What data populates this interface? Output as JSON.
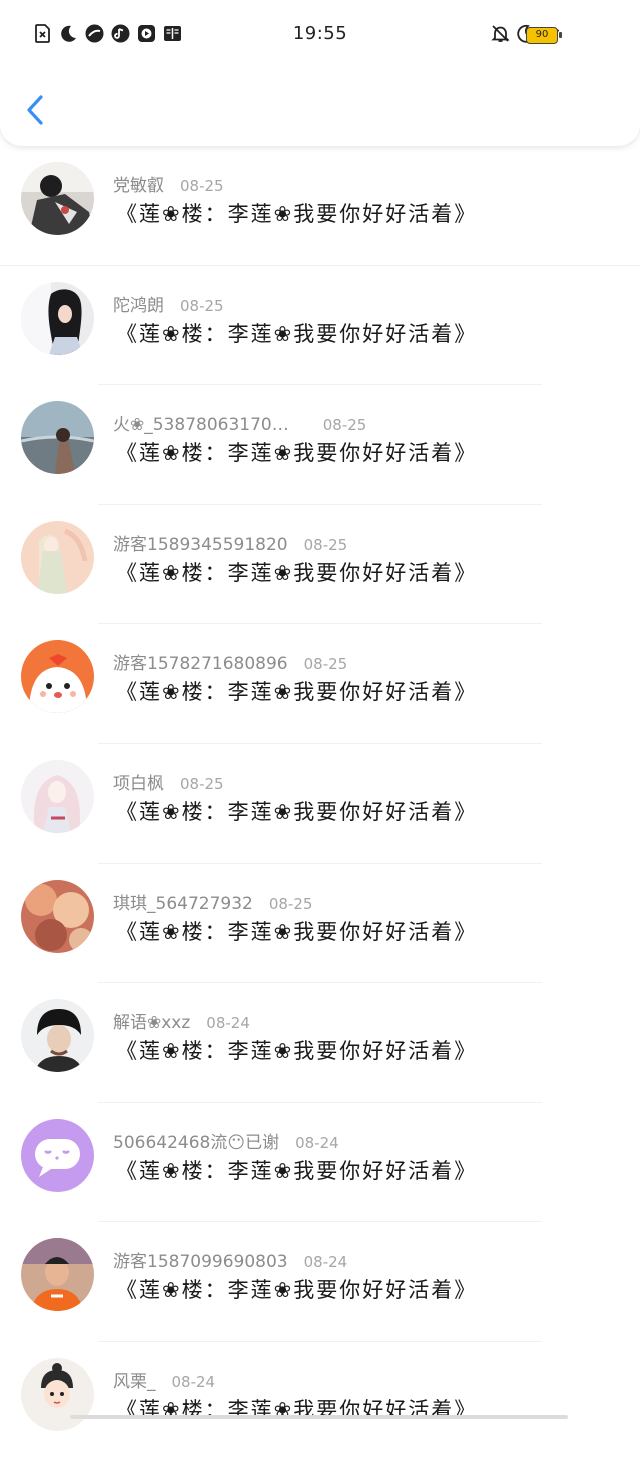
{
  "status_bar": {
    "time": "19:55",
    "battery": "90",
    "left_icons": [
      "sim-x-icon",
      "moon-icon",
      "cloud-app-icon",
      "music-app-icon",
      "video-app-icon",
      "book-app-icon"
    ],
    "right_icons": [
      "mute-bell-icon",
      "moon-icon",
      "wifi-icon"
    ]
  },
  "header": {
    "back_icon": "chevron-left-icon",
    "accent_color": "#3a8ef6"
  },
  "list": {
    "items": [
      {
        "name": "党敏叡",
        "date": "08-25",
        "title": "《莲❀楼：李莲❀我要你好好活着》",
        "avatar": "photo-dark"
      },
      {
        "name": "陀鸿朗",
        "date": "08-25",
        "title": "《莲❀楼：李莲❀我要你好好活着》",
        "avatar": "photo-girl"
      },
      {
        "name": "火❀_53878063170…",
        "date": "08-25",
        "title": "《莲❀楼：李莲❀我要你好好活着》",
        "avatar": "photo-sea"
      },
      {
        "name": "游客1589345591820",
        "date": "08-25",
        "title": "《莲❀楼：李莲❀我要你好好活着》",
        "avatar": "photo-peach"
      },
      {
        "name": "游客1578271680896",
        "date": "08-25",
        "title": "《莲❀楼：李莲❀我要你好好活着》",
        "avatar": "cartoon-orange"
      },
      {
        "name": "项白枫",
        "date": "08-25",
        "title": "《莲❀楼：李莲❀我要你好好活着》",
        "avatar": "anime-girl"
      },
      {
        "name": "琪琪_564727932",
        "date": "08-25",
        "title": "《莲❀楼：李莲❀我要你好好活着》",
        "avatar": "photo-autumn"
      },
      {
        "name": "解语❀xxz",
        "date": "08-24",
        "title": "《莲❀楼：李莲❀我要你好好活着》",
        "avatar": "photo-boy"
      },
      {
        "name": "506642468流😶已谢",
        "date": "08-24",
        "title": "《莲❀楼：李莲❀我要你好好活着》",
        "avatar": "default-purple"
      },
      {
        "name": "游客1587099690803",
        "date": "08-24",
        "title": "《莲❀楼：李莲❀我要你好好活着》",
        "avatar": "photo-kid"
      },
      {
        "name": "风栗_",
        "date": "08-24",
        "title": "《莲❀楼：李莲❀我要你好好活着》",
        "avatar": "cartoon-chibi"
      }
    ]
  },
  "colors": {
    "name": "#8c8c8c",
    "date": "#a6a6a6",
    "title": "#1a1a1a",
    "battery": "#f6c200"
  }
}
